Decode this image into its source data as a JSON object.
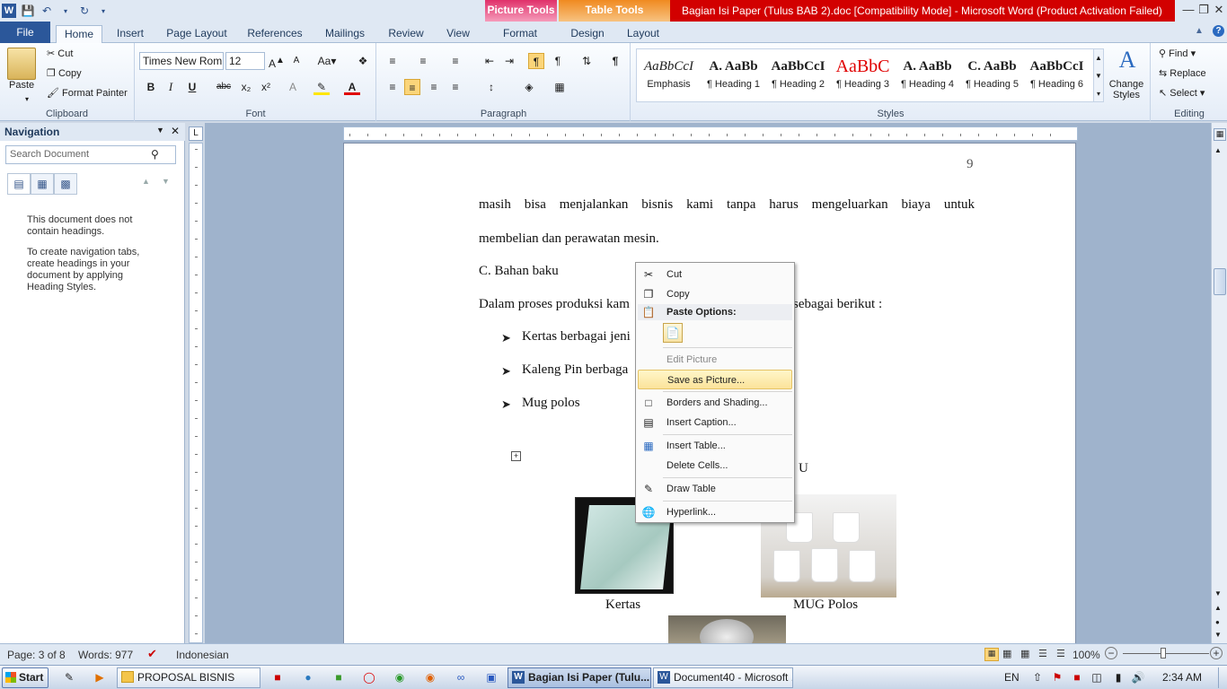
{
  "window": {
    "title": "Bagian Isi Paper (Tulus BAB 2).doc [Compatibility Mode]  -  Microsoft Word (Product Activation Failed)",
    "context_tabs": [
      "Picture Tools",
      "Table Tools"
    ],
    "brand_color": "#2b579a"
  },
  "tabs": [
    "File",
    "Home",
    "Insert",
    "Page Layout",
    "References",
    "Mailings",
    "Review",
    "View",
    "Format",
    "Design",
    "Layout"
  ],
  "ribbon": {
    "clipboard": {
      "paste": "Paste",
      "cut": "Cut",
      "copy": "Copy",
      "format_painter": "Format Painter",
      "label": "Clipboard"
    },
    "font": {
      "name": "Times New Rom",
      "size": "12",
      "bold": "B",
      "italic": "I",
      "underline": "U",
      "strike": "abc",
      "sub": "x₂",
      "sup": "x²",
      "label": "Font"
    },
    "paragraph": {
      "label": "Paragraph"
    },
    "styles": {
      "items": [
        {
          "preview": "AaBbCcI",
          "name": "Emphasis"
        },
        {
          "preview": "A.  AaBb",
          "name": "¶ Heading 1"
        },
        {
          "preview": "AaBbCcI",
          "name": "¶ Heading 2"
        },
        {
          "preview": "AaBbC",
          "name": "¶ Heading 3"
        },
        {
          "preview": "A.  AaBb",
          "name": "¶ Heading 4"
        },
        {
          "preview": "C.  AaBb",
          "name": "¶ Heading 5"
        },
        {
          "preview": "AaBbCcI",
          "name": "¶ Heading 6"
        }
      ],
      "change_styles": "Change Styles",
      "label": "Styles"
    },
    "editing": {
      "find": "Find",
      "replace": "Replace",
      "select": "Select",
      "label": "Editing"
    }
  },
  "navigation": {
    "title": "Navigation",
    "search_placeholder": "Search Document",
    "msg1": "This document does not contain headings.",
    "msg2": "To create navigation tabs, create headings in your document by applying Heading Styles."
  },
  "document": {
    "page_number": "9",
    "line1": "masih bisa menjalankan bisnis kami tanpa harus mengeluarkan biaya untuk",
    "line2": "membelian dan perawatan mesin.",
    "heading": "C. Bahan baku",
    "intro_start": "Dalam proses produksi kam",
    "intro_end": "sebagai berikut :",
    "bullets": [
      "Kertas berbagai jeni",
      "Kaleng Pin berbaga",
      "Mug polos"
    ],
    "table_partial": "U",
    "captions": [
      "Kertas",
      "MUG Polos"
    ]
  },
  "context_menu": {
    "items": [
      "Cut",
      "Copy",
      "Paste Options:",
      "Edit Picture",
      "Save as Picture...",
      "Borders and Shading...",
      "Insert Caption...",
      "Insert Table...",
      "Delete Cells...",
      "Draw Table",
      "Hyperlink..."
    ],
    "highlighted": "Save as Picture..."
  },
  "status": {
    "page": "Page: 3 of 8",
    "words": "Words: 977",
    "language": "Indonesian",
    "zoom": "100%"
  },
  "taskbar": {
    "start": "Start",
    "buttons": [
      "PROPOSAL BISNIS",
      "Bagian Isi Paper (Tulu...",
      "Document40 - Microsoft ..."
    ],
    "lang": "EN",
    "time": "2:34 AM"
  }
}
